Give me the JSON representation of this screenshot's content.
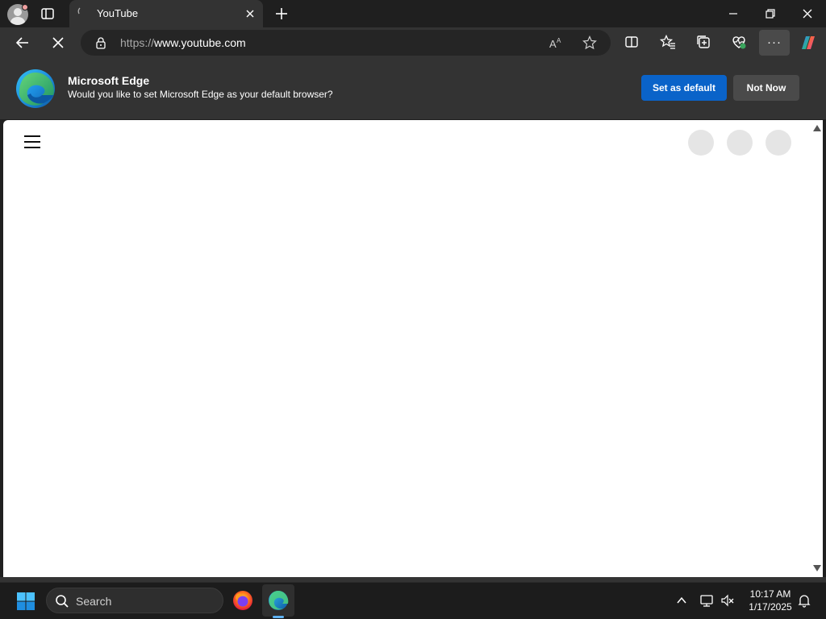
{
  "browser": {
    "tab": {
      "title": "YouTube"
    },
    "address_bar": {
      "url_scheme": "https://",
      "url_host": "www.youtube.com"
    },
    "more_label": "···"
  },
  "banner": {
    "title": "Microsoft Edge",
    "message": "Would you like to set Microsoft Edge as your default browser?",
    "primary_button": "Set as default",
    "secondary_button": "Not Now",
    "colors": {
      "primary": "#0a63c9",
      "secondary": "#4a4a4a"
    }
  },
  "page": {
    "site": "YouTube",
    "state": "loading",
    "skeleton_avatars": 3
  },
  "taskbar": {
    "search_label": "Search",
    "apps": [
      "firefox-icon",
      "edge-icon"
    ],
    "active_app": "edge-icon",
    "clock_time": "10:17 AM",
    "clock_date": "1/17/2025"
  }
}
